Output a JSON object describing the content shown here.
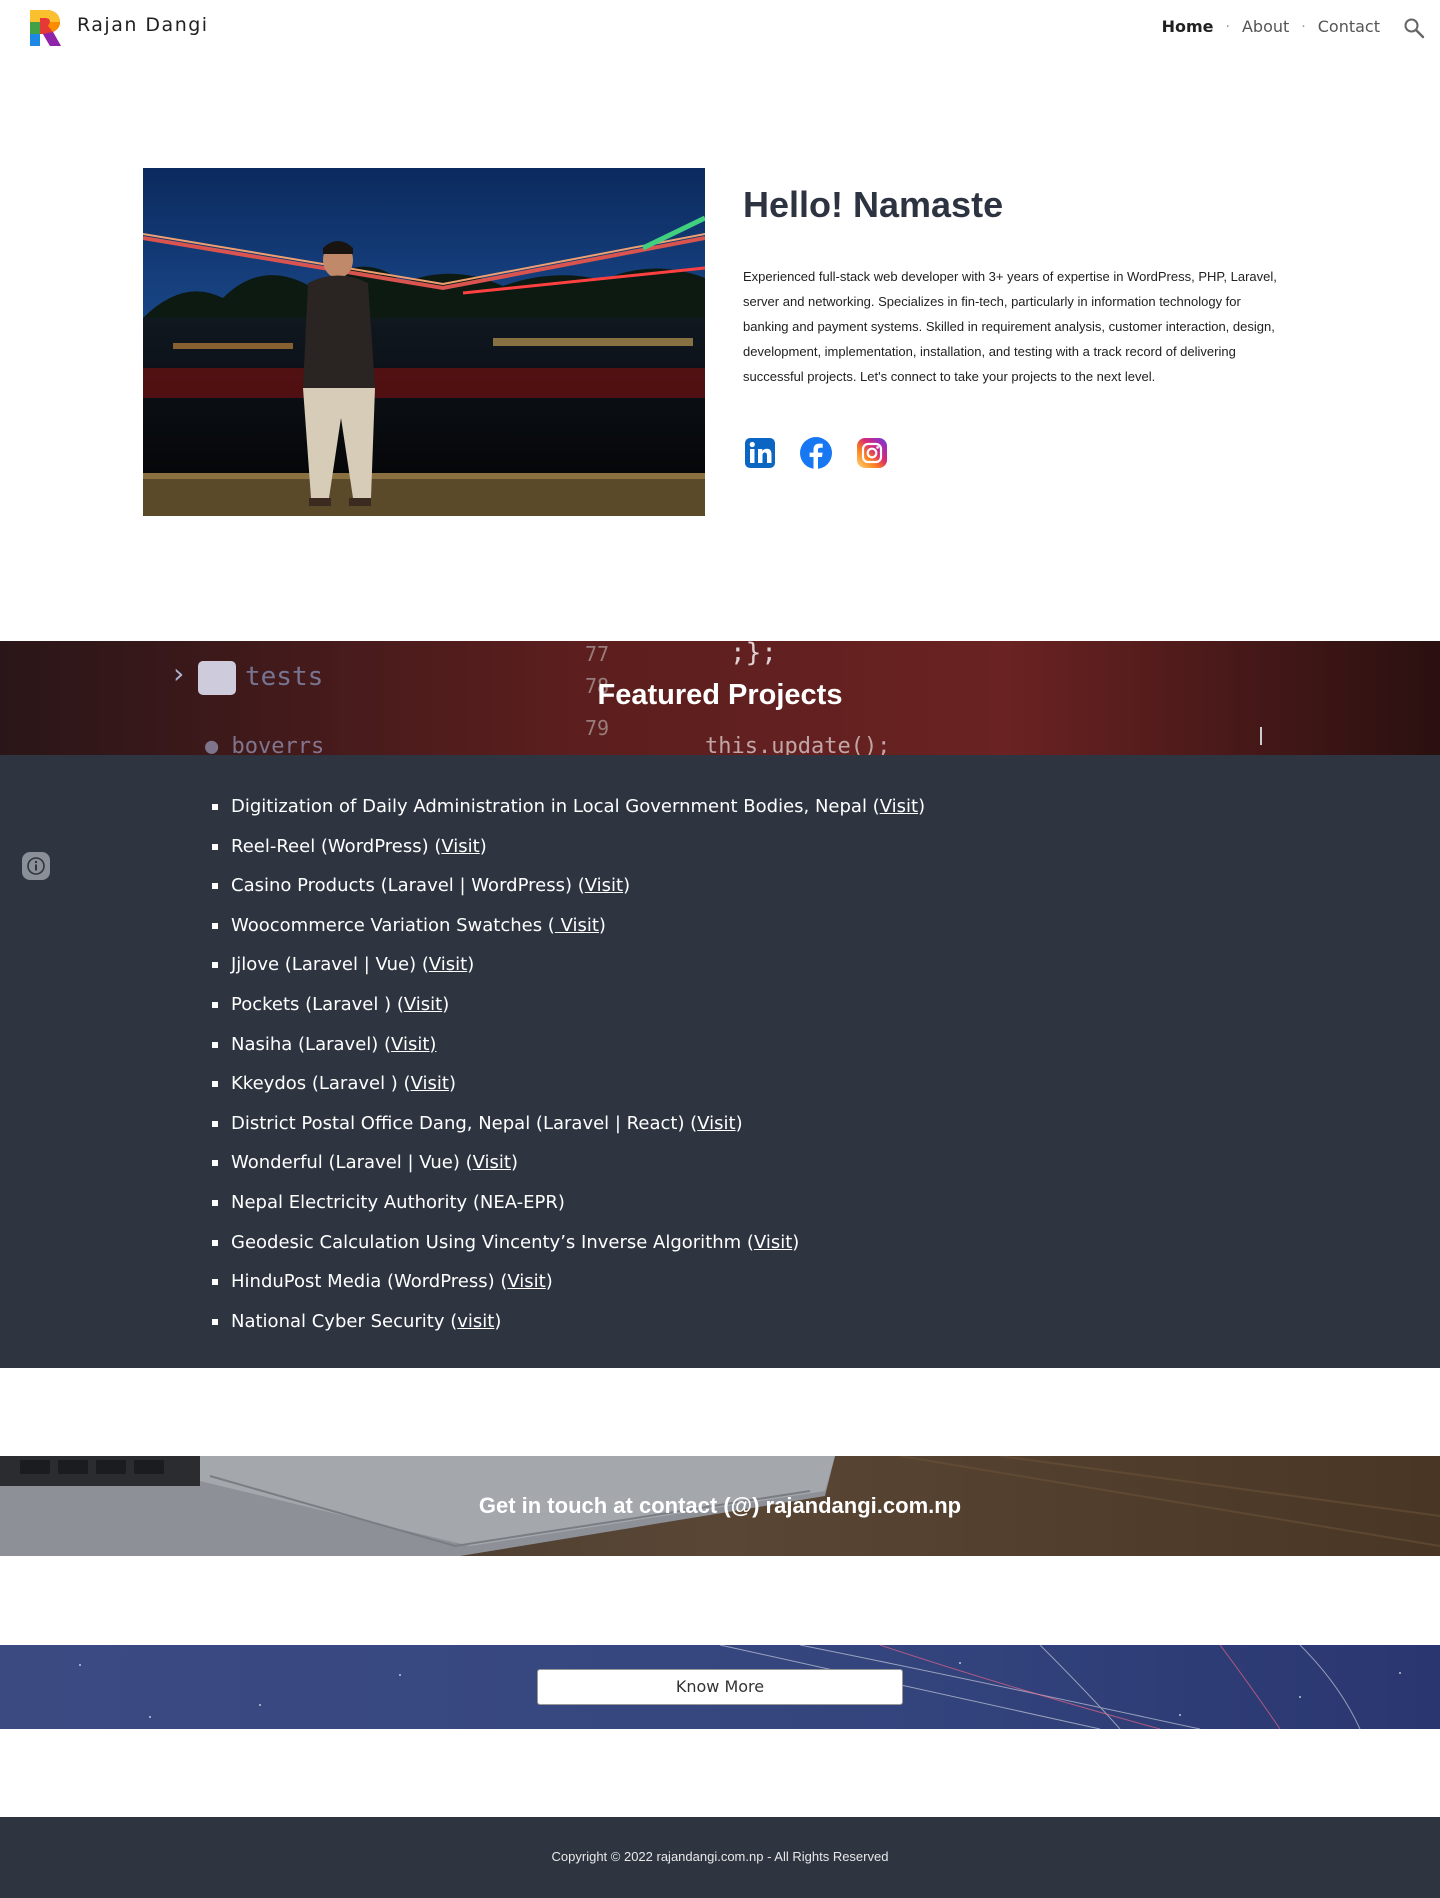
{
  "header": {
    "site_title": "Rajan Dangi",
    "nav": [
      {
        "label": "Home",
        "active": true
      },
      {
        "label": "About",
        "active": false
      },
      {
        "label": "Contact",
        "active": false
      }
    ],
    "separator": "·",
    "search_icon": "search-icon"
  },
  "intro": {
    "heading": "Hello! Namaste",
    "text": "Experienced full-stack web developer with 3+ years of expertise in WordPress, PHP, Laravel, server and networking. Specializes in fin-tech, particularly in information technology for banking and payment systems. Skilled in requirement analysis, customer interaction, design, development, implementation, installation, and testing with a track record of delivering successful projects. Let's connect to take your projects to the next level.",
    "social": [
      "linkedin-icon",
      "facebook-icon",
      "instagram-icon"
    ]
  },
  "featured": {
    "title": "Featured Projects",
    "projects": [
      {
        "text": "Digitization of Daily Administration in Local Government Bodies, Nepal (",
        "link": "Visit",
        "after": ")"
      },
      {
        "text": "Reel-Reel (WordPress) (",
        "link": "Visit",
        "after": ")"
      },
      {
        "text": "Casino Products (Laravel | WordPress) (",
        "link": "Visit",
        "after": ")"
      },
      {
        "text": "Woocommerce Variation Swatches (",
        "link": " Visit",
        "after": ")"
      },
      {
        "text": " Jjlove (Laravel | Vue) (",
        "link": "Visit",
        "after": ")"
      },
      {
        "text": "Pockets (Laravel ) (",
        "link": "Visit",
        "after": ")"
      },
      {
        "text": "Nasiha (Laravel) (",
        "link": "Visit) ",
        "after": ""
      },
      {
        "text": "Kkeydos (Laravel ) (",
        "link": "Visit",
        "after": ")"
      },
      {
        "text": "District Postal Office Dang, Nepal (Laravel | React) (",
        "link": "Visit",
        "after": ")"
      },
      {
        "text": "Wonderful (Laravel | Vue) (",
        "link": "Visit",
        "after": ")"
      },
      {
        "text": "Nepal Electricity Authority (NEA-EPR)",
        "link": "",
        "after": ""
      },
      {
        "text": "Geodesic Calculation Using Vincenty’s Inverse Algorithm (",
        "link": "Visit",
        "after": ")"
      },
      {
        "text": "HinduPost Media (WordPress) (",
        "link": "Visit",
        "after": ")"
      },
      {
        "text": "National Cyber Security (",
        "link": "visit",
        "after": ")"
      }
    ]
  },
  "contact": {
    "text": "Get in touch at contact (@) rajandangi.com.np"
  },
  "know_more": {
    "button_label": "Know More"
  },
  "footer": {
    "copyright": "Copyright © 2022 rajandangi.com.np - All Rights Reserved"
  }
}
